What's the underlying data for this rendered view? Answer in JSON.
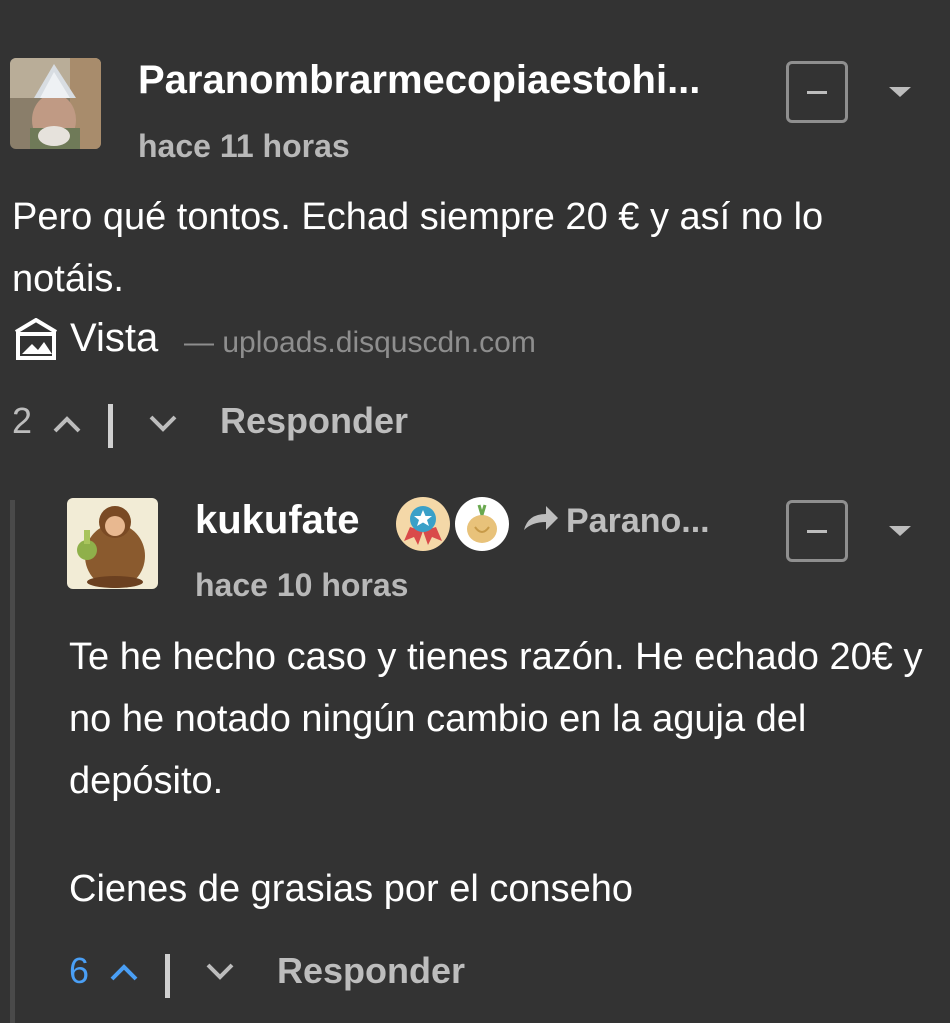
{
  "comments": [
    {
      "username": "Paranombrarmecopiaestohi...",
      "time": "hace 11 horas",
      "text": "Pero qué tontos. Echad siempre 20 € y así no lo notáis.",
      "media": {
        "icon": "image-icon",
        "label": "Vista",
        "source": "— uploads.disquscdn.com"
      },
      "votes": "2",
      "reply": "Responder"
    },
    {
      "username": "kukufate",
      "reply_to": "Parano...",
      "badges": [
        "medal-badge-icon",
        "onion-badge-icon"
      ],
      "time": "hace 10 horas",
      "text_p1": "Te he hecho caso y tienes razón. He echado 20€ y no he notado ningún cambio en la aguja del depósito.",
      "text_p2": "Cienes de grasias por el conseho",
      "votes": "6",
      "reply": "Responder"
    }
  ],
  "colors": {
    "background": "#333333",
    "upvote_active": "#4a9ff5",
    "muted": "#bdbdbd"
  }
}
